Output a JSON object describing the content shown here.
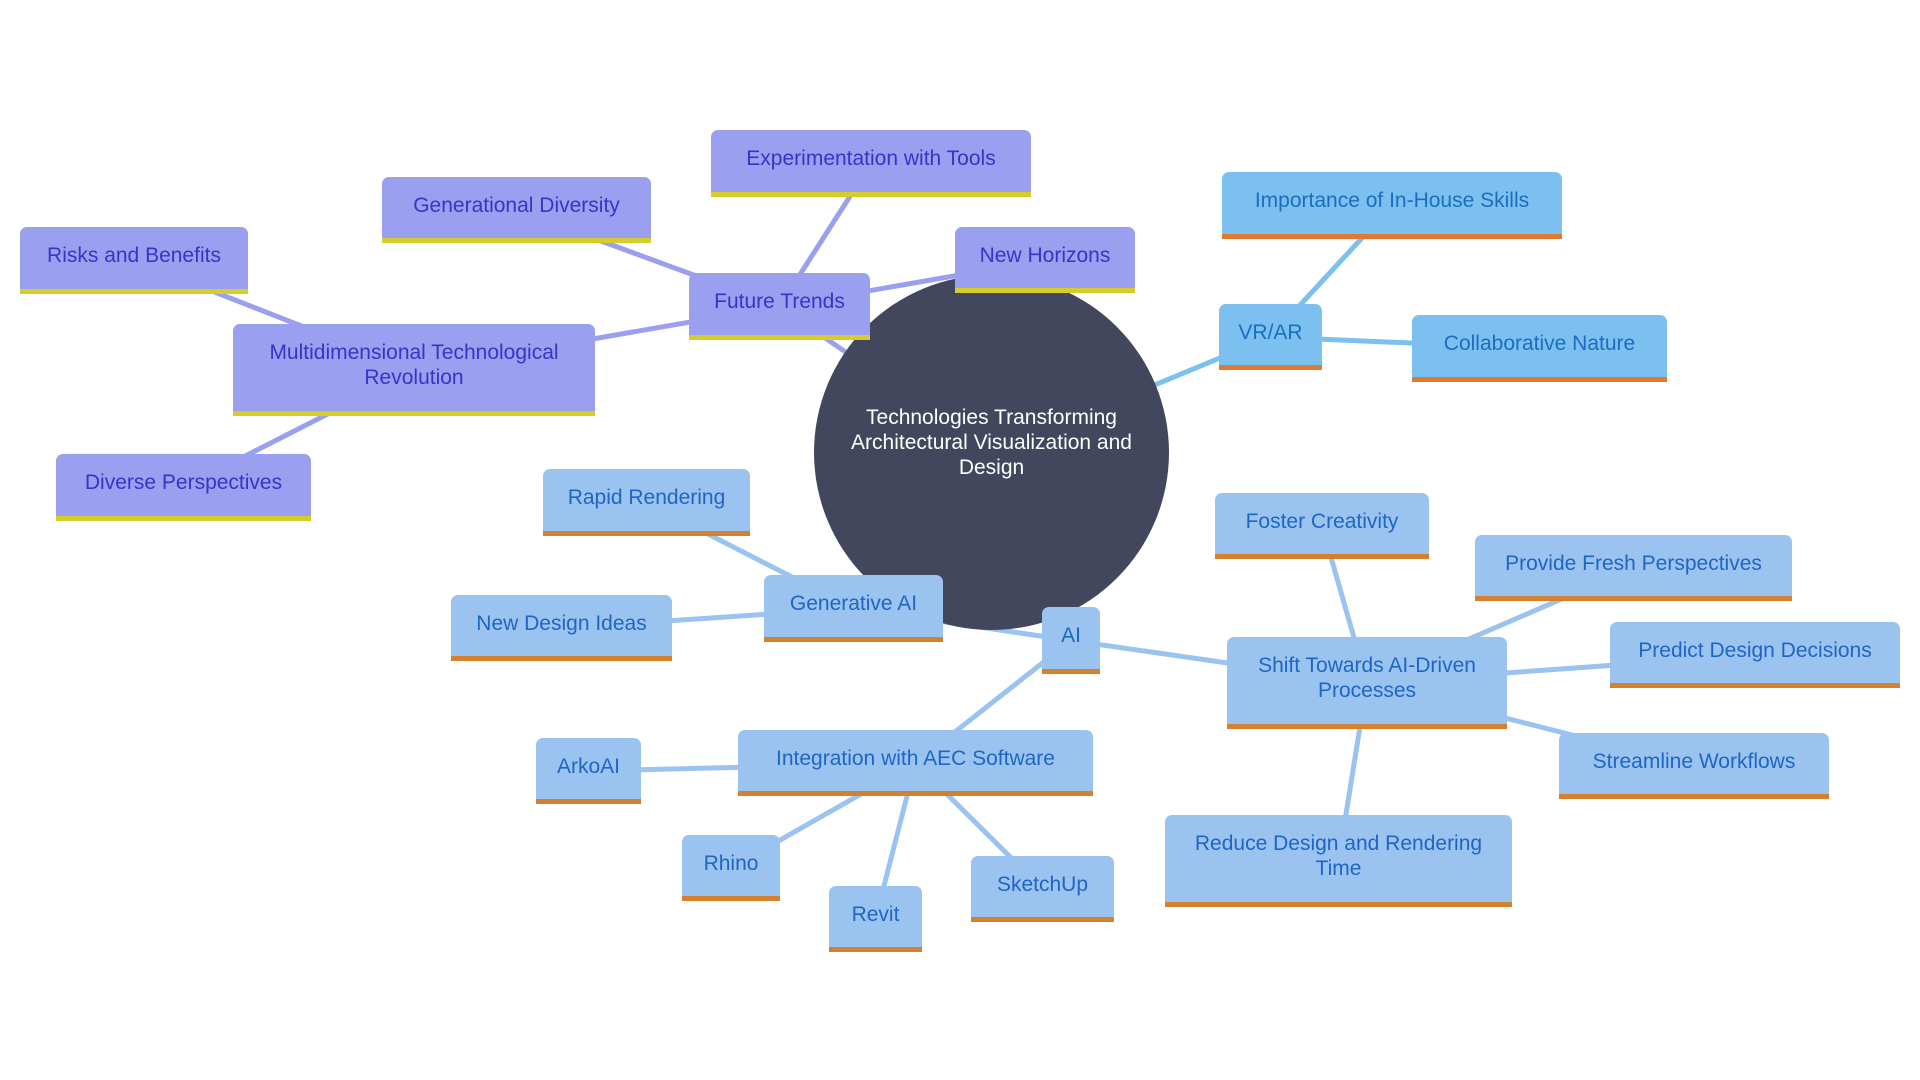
{
  "diagram": {
    "type": "mindmap",
    "colors": {
      "root_fill": "#42475e",
      "root_text": "#ffffff",
      "future_trends_fill": "#9b9ff0",
      "future_trends_text": "#3535c8",
      "future_trends_accent": "#d6cc2b",
      "ai_fill": "#9ac3f0",
      "ai_text": "#1f66c4",
      "ai_accent": "#d4812f",
      "vrar_fill": "#7cc0f0",
      "vrar_text": "#1a6ebf",
      "vrar_accent": "#e07a32"
    },
    "root": {
      "id": "root",
      "label": "Technologies Transforming Architectural Visualization and Design"
    },
    "nodes": [
      {
        "id": "future-trends",
        "label": "Future Trends",
        "parent": "root",
        "branch": "purple"
      },
      {
        "id": "experimentation",
        "label": "Experimentation with Tools",
        "parent": "future-trends",
        "branch": "purple"
      },
      {
        "id": "generational",
        "label": "Generational Diversity",
        "parent": "future-trends",
        "branch": "purple"
      },
      {
        "id": "new-horizons",
        "label": "New Horizons",
        "parent": "future-trends",
        "branch": "purple"
      },
      {
        "id": "multidimensional",
        "label": "Multidimensional Technological Revolution",
        "parent": "future-trends",
        "branch": "purple"
      },
      {
        "id": "risks",
        "label": "Risks and Benefits",
        "parent": "multidimensional",
        "branch": "purple"
      },
      {
        "id": "diverse",
        "label": "Diverse Perspectives",
        "parent": "multidimensional",
        "branch": "purple"
      },
      {
        "id": "vrar",
        "label": "VR/AR",
        "parent": "root",
        "branch": "sky"
      },
      {
        "id": "importance",
        "label": "Importance of In-House Skills",
        "parent": "vrar",
        "branch": "sky"
      },
      {
        "id": "collaborative",
        "label": "Collaborative Nature",
        "parent": "vrar",
        "branch": "sky"
      },
      {
        "id": "ai",
        "label": "AI",
        "parent": "root",
        "branch": "blue"
      },
      {
        "id": "generative",
        "label": "Generative AI",
        "parent": "ai",
        "branch": "blue"
      },
      {
        "id": "rapid",
        "label": "Rapid Rendering",
        "parent": "generative",
        "branch": "blue"
      },
      {
        "id": "new-design",
        "label": "New Design Ideas",
        "parent": "generative",
        "branch": "blue"
      },
      {
        "id": "integration",
        "label": "Integration with AEC Software",
        "parent": "ai",
        "branch": "blue"
      },
      {
        "id": "arkoai",
        "label": "ArkoAI",
        "parent": "integration",
        "branch": "blue"
      },
      {
        "id": "rhino",
        "label": "Rhino",
        "parent": "integration",
        "branch": "blue"
      },
      {
        "id": "revit",
        "label": "Revit",
        "parent": "integration",
        "branch": "blue"
      },
      {
        "id": "sketchup",
        "label": "SketchUp",
        "parent": "integration",
        "branch": "blue"
      },
      {
        "id": "shift",
        "label": "Shift Towards AI-Driven Processes",
        "parent": "ai",
        "branch": "blue"
      },
      {
        "id": "foster",
        "label": "Foster Creativity",
        "parent": "shift",
        "branch": "blue"
      },
      {
        "id": "fresh",
        "label": "Provide Fresh Perspectives",
        "parent": "shift",
        "branch": "blue"
      },
      {
        "id": "predict",
        "label": "Predict Design Decisions",
        "parent": "shift",
        "branch": "blue"
      },
      {
        "id": "streamline",
        "label": "Streamline Workflows",
        "parent": "shift",
        "branch": "blue"
      },
      {
        "id": "reduce",
        "label": "Reduce Design and Rendering Time",
        "parent": "shift",
        "branch": "blue"
      }
    ]
  }
}
